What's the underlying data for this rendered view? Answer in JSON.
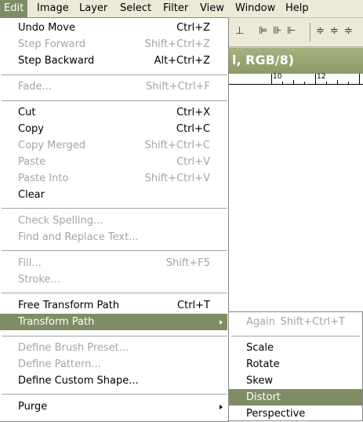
{
  "menubar": {
    "items": [
      {
        "label": "Edit",
        "active": true
      },
      {
        "label": "Image"
      },
      {
        "label": "Layer"
      },
      {
        "label": "Select"
      },
      {
        "label": "Filter"
      },
      {
        "label": "View"
      },
      {
        "label": "Window"
      },
      {
        "label": "Help"
      }
    ]
  },
  "document": {
    "title_fragment": "l, RGB/8)",
    "ruler_labels": [
      "10",
      "12"
    ]
  },
  "edit_menu": {
    "items": [
      {
        "label": "Undo Move",
        "shortcut": "Ctrl+Z",
        "enabled": true
      },
      {
        "label": "Step Forward",
        "shortcut": "Shift+Ctrl+Z",
        "enabled": false
      },
      {
        "label": "Step Backward",
        "shortcut": "Alt+Ctrl+Z",
        "enabled": true
      },
      {
        "label": "Fade...",
        "shortcut": "Shift+Ctrl+F",
        "enabled": false
      },
      {
        "label": "Cut",
        "shortcut": "Ctrl+X",
        "enabled": true
      },
      {
        "label": "Copy",
        "shortcut": "Ctrl+C",
        "enabled": true
      },
      {
        "label": "Copy Merged",
        "shortcut": "Shift+Ctrl+C",
        "enabled": false
      },
      {
        "label": "Paste",
        "shortcut": "Ctrl+V",
        "enabled": false
      },
      {
        "label": "Paste Into",
        "shortcut": "Shift+Ctrl+V",
        "enabled": false
      },
      {
        "label": "Clear",
        "shortcut": "",
        "enabled": true
      },
      {
        "label": "Check Spelling...",
        "shortcut": "",
        "enabled": false
      },
      {
        "label": "Find and Replace Text...",
        "shortcut": "",
        "enabled": false
      },
      {
        "label": "Fill...",
        "shortcut": "Shift+F5",
        "enabled": false
      },
      {
        "label": "Stroke...",
        "shortcut": "",
        "enabled": false
      },
      {
        "label": "Free Transform Path",
        "shortcut": "Ctrl+T",
        "enabled": true
      },
      {
        "label": "Transform Path",
        "shortcut": "",
        "enabled": true,
        "highlighted": true,
        "submenu": true
      },
      {
        "label": "Define Brush Preset...",
        "shortcut": "",
        "enabled": false
      },
      {
        "label": "Define Pattern...",
        "shortcut": "",
        "enabled": false
      },
      {
        "label": "Define Custom Shape...",
        "shortcut": "",
        "enabled": true
      },
      {
        "label": "Purge",
        "shortcut": "",
        "enabled": true,
        "submenu": true
      }
    ]
  },
  "transform_submenu": {
    "items": [
      {
        "label": "Again",
        "shortcut": "Shift+Ctrl+T",
        "enabled": false
      },
      {
        "label": "Scale",
        "enabled": true
      },
      {
        "label": "Rotate",
        "enabled": true
      },
      {
        "label": "Skew",
        "enabled": true
      },
      {
        "label": "Distort",
        "enabled": true,
        "highlighted": true
      },
      {
        "label": "Perspective",
        "enabled": true
      }
    ]
  },
  "colors": {
    "highlight": "#7f8d65",
    "disabled_text": "#a5a5a5",
    "menubar_bg": "#ece9d8",
    "doc_title_bg": "#8c9a68"
  }
}
